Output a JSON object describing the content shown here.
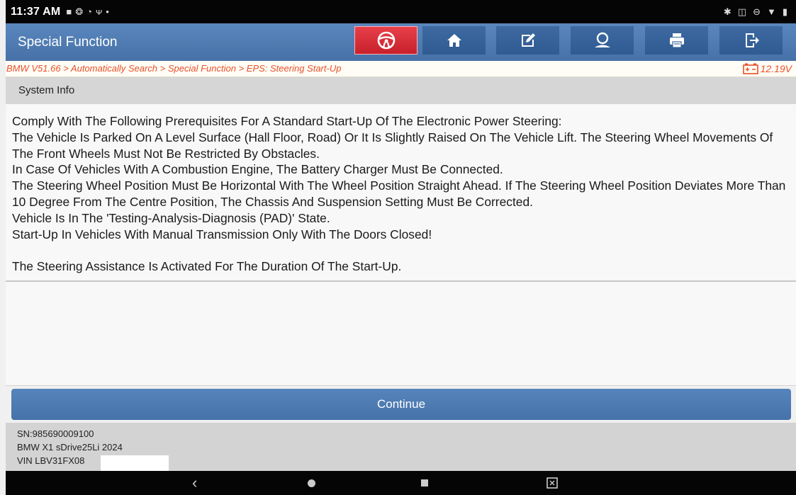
{
  "status_bar": {
    "time": "11:37 AM",
    "left_icons": [
      "message-icon",
      "settings-circle-icon",
      "wifi-off-icon",
      "usb-icon",
      "dot-icon"
    ],
    "right_icons": [
      "bluetooth-icon",
      "vibrate-icon",
      "dnd-icon",
      "wifi-icon",
      "battery-icon"
    ]
  },
  "header": {
    "title": "Special Function",
    "buttons": [
      {
        "name": "vehicle-connect-button",
        "icon": "steering-wheel-icon"
      },
      {
        "name": "home-button",
        "icon": "home-icon"
      },
      {
        "name": "edit-button",
        "icon": "edit-icon"
      },
      {
        "name": "support-button",
        "icon": "person-icon"
      },
      {
        "name": "print-button",
        "icon": "printer-icon"
      },
      {
        "name": "exit-button",
        "icon": "exit-icon"
      }
    ],
    "colors": {
      "bar": "#4a77ae",
      "alert_button": "#d92c36"
    }
  },
  "breadcrumb": {
    "path": "BMW V51.66 > Automatically Search > Special Function > EPS: Steering Start-Up",
    "voltage": "12.19V",
    "color": "#e8502a"
  },
  "section": {
    "title": "System Info",
    "body": "Comply With The Following Prerequisites For A Standard Start-Up Of The Electronic Power Steering:\n The Vehicle Is Parked On A Level Surface (Hall Floor, Road) Or It Is Slightly Raised On The Vehicle Lift. The Steering Wheel Movements Of The Front Wheels Must Not Be Restricted By Obstacles.\n In Case Of Vehicles With A Combustion Engine, The Battery Charger Must Be Connected.\n The Steering Wheel Position Must Be Horizontal With The Wheel Position Straight Ahead. If The Steering Wheel Position Deviates More Than 10 Degree  From The Centre Position, The Chassis And Suspension Setting Must Be Corrected.\n Vehicle Is In The 'Testing-Analysis-Diagnosis (PAD)' State.\n Start-Up In Vehicles With Manual Transmission Only With The Doors Closed!\n\nThe Steering Assistance Is Activated For The Duration Of The Start-Up."
  },
  "actions": {
    "continue_label": "Continue"
  },
  "footer": {
    "sn": "SN:985690009100",
    "model": "BMW X1 sDrive25Li 2024",
    "vin": "VIN LBV31FX08"
  },
  "nav_bar": {
    "back_glyph": "‹"
  }
}
